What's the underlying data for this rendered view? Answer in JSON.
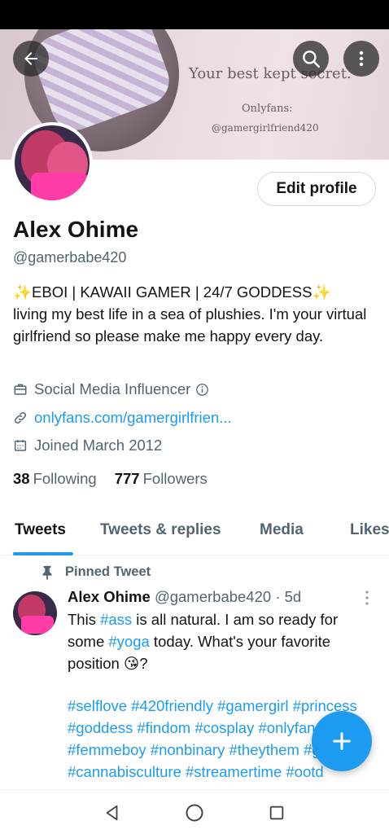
{
  "banner": {
    "tagline": "Your best kept secret.",
    "sub1": "Onlyfans:",
    "sub2": "@gamergirlfriend420"
  },
  "profile": {
    "edit_label": "Edit profile",
    "name": "Alex Ohime",
    "handle": "@gamerbabe420",
    "bio_line1": "✨EBOI | KAWAII GAMER | 24/7 GODDESS✨",
    "bio_rest": "living my best life in a sea of plushies. I'm your virtual girlfriend so please make me happy every day.",
    "profession": "Social Media Influencer",
    "link": "onlyfans.com/gamergirlfrien...",
    "joined": "Joined March 2012",
    "following_count": "38",
    "following_label": "Following",
    "followers_count": "777",
    "followers_label": "Followers"
  },
  "tabs": [
    {
      "label": "Tweets",
      "active": true
    },
    {
      "label": "Tweets & replies",
      "active": false
    },
    {
      "label": "Media",
      "active": false
    },
    {
      "label": "Likes",
      "active": false
    }
  ],
  "tweet": {
    "pinned_label": "Pinned Tweet",
    "author_name": "Alex Ohime",
    "author_handle": "@gamerbabe420",
    "separator": "·",
    "time": "5d",
    "text_1": "This ",
    "tag_ass": "#ass",
    "text_2": " is all natural. I am so ready for some ",
    "tag_yoga": "#yoga",
    "text_3": " today. What's your favorite position 😘?",
    "hashtags": "#selflove #420friendly #gamergirl #princess #goddess #findom #cosplay #onlyfans #femmeboy #nonbinary #theythem #gamer #cannabisculture #streamertime #ootd"
  },
  "colors": {
    "accent": "#1d9bf0",
    "text": "#0f1419",
    "secondary": "#536471"
  }
}
